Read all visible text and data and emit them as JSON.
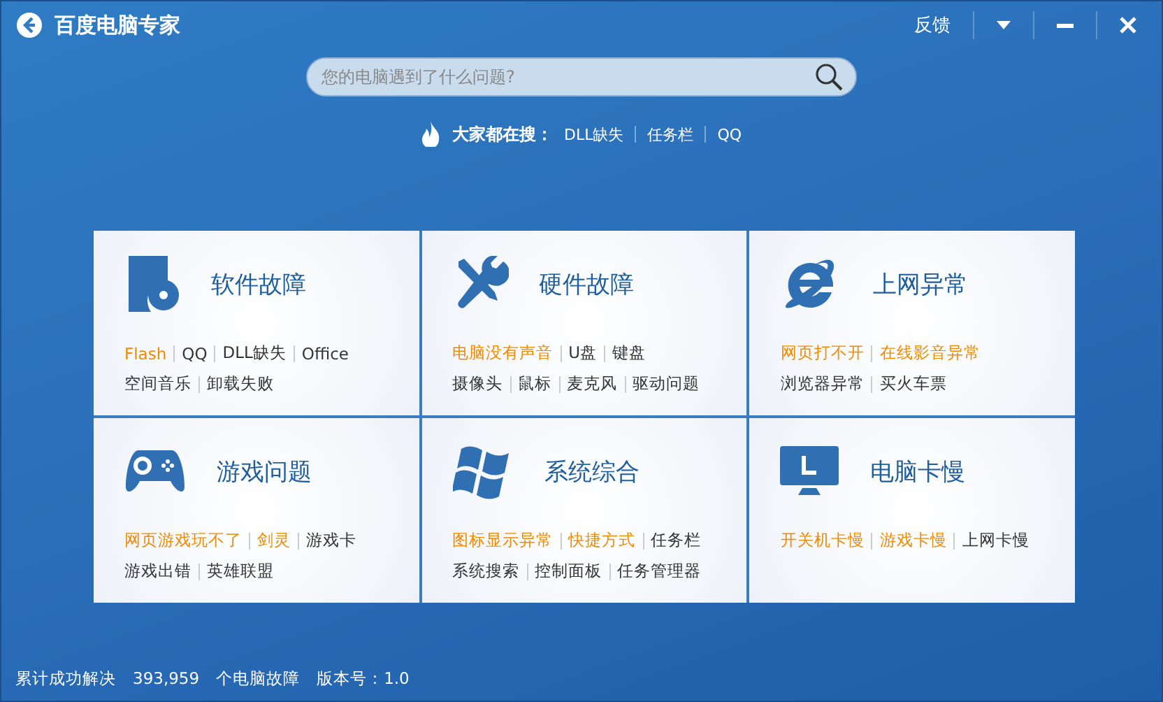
{
  "window": {
    "title": "百度电脑专家",
    "controls": [
      "反馈"
    ]
  },
  "search": {
    "placeholder": "您的电脑遇到了什么问题?"
  },
  "hot_search": {
    "label": "大家都在搜：",
    "items": [
      "DLL缺失",
      "任务栏",
      "QQ"
    ]
  },
  "cards": [
    {
      "kind": "software",
      "title": "软件故障",
      "lines": [
        {
          "links": [
            {
              "text": "Flash",
              "hot": true
            },
            {
              "text": "QQ",
              "hot": false
            },
            {
              "text": "DLL缺失",
              "hot": false
            },
            {
              "text": "Office",
              "hot": false
            }
          ]
        },
        {
          "links": [
            {
              "text": "空间音乐",
              "hot": false
            },
            {
              "text": "卸载失败",
              "hot": false
            }
          ]
        }
      ]
    },
    {
      "kind": "hardware",
      "title": "硬件故障",
      "lines": [
        {
          "links": [
            {
              "text": "电脑没有声音",
              "hot": true
            },
            {
              "text": "U盘",
              "hot": false
            },
            {
              "text": "键盘",
              "hot": false
            }
          ]
        },
        {
          "links": [
            {
              "text": "摄像头",
              "hot": false
            },
            {
              "text": "鼠标",
              "hot": false
            },
            {
              "text": "麦克风",
              "hot": false
            },
            {
              "text": "驱动问题",
              "hot": false
            }
          ]
        }
      ]
    },
    {
      "kind": "internet",
      "title": "上网异常",
      "lines": [
        {
          "links": [
            {
              "text": "网页打不开",
              "hot": true
            },
            {
              "text": "在线影音异常",
              "hot": true
            }
          ]
        },
        {
          "links": [
            {
              "text": "浏览器异常",
              "hot": false
            },
            {
              "text": "买火车票",
              "hot": false
            }
          ]
        }
      ]
    },
    {
      "kind": "game",
      "title": "游戏问题",
      "lines": [
        {
          "links": [
            {
              "text": "网页游戏玩不了",
              "hot": true
            },
            {
              "text": "剑灵",
              "hot": true
            },
            {
              "text": "游戏卡",
              "hot": false
            }
          ]
        },
        {
          "links": [
            {
              "text": "游戏出错",
              "hot": false
            },
            {
              "text": "英雄联盟",
              "hot": false
            }
          ]
        }
      ]
    },
    {
      "kind": "system",
      "title": "系统综合",
      "lines": [
        {
          "links": [
            {
              "text": "图标显示异常",
              "hot": true
            },
            {
              "text": "快捷方式",
              "hot": true
            },
            {
              "text": "任务栏",
              "hot": false
            }
          ]
        },
        {
          "links": [
            {
              "text": "系统搜索",
              "hot": false
            },
            {
              "text": "控制面板",
              "hot": false
            },
            {
              "text": "任务管理器",
              "hot": false
            }
          ]
        }
      ]
    },
    {
      "kind": "slow",
      "title": "电脑卡慢",
      "lines": [
        {
          "links": [
            {
              "text": "开关机卡慢",
              "hot": true
            },
            {
              "text": "游戏卡慢",
              "hot": true
            },
            {
              "text": "上网卡慢",
              "hot": false
            }
          ]
        }
      ]
    }
  ],
  "status_bar": {
    "label": "累计成功解决",
    "count": "393,959",
    "unit": "个电脑故障",
    "version": "版本号：1.0"
  }
}
